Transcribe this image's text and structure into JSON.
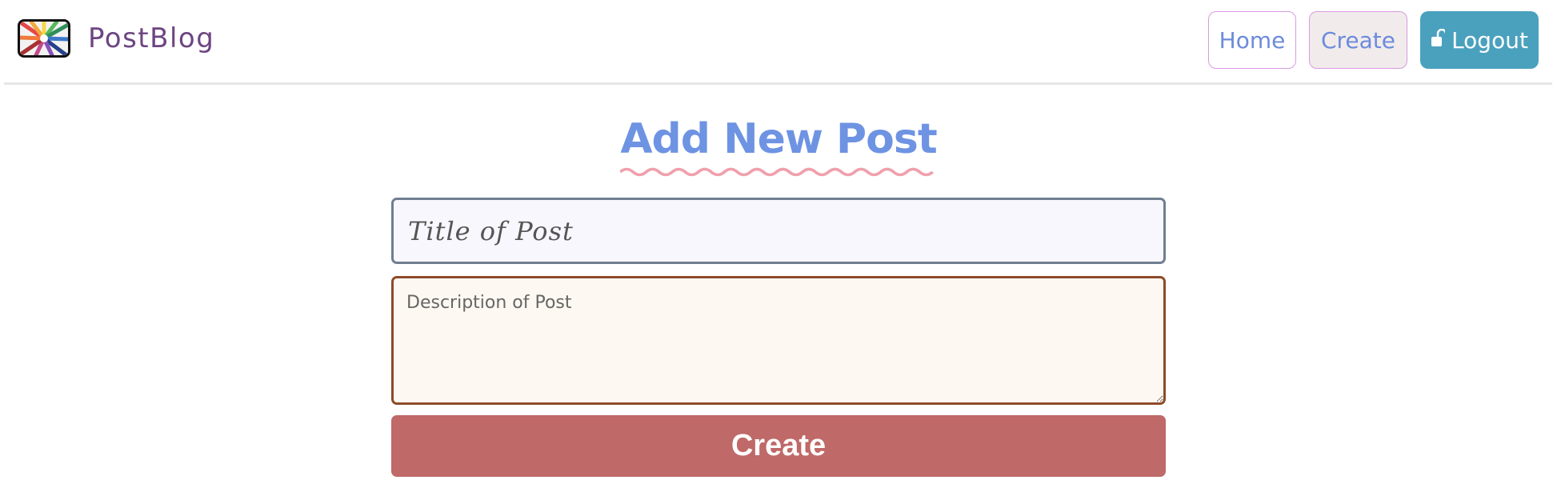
{
  "brand": {
    "name": "PostBlog",
    "logo_icon": "colored-pencils-logo"
  },
  "nav": {
    "home_label": "Home",
    "create_label": "Create",
    "logout_label": "Logout",
    "logout_icon": "unlock-icon"
  },
  "page": {
    "heading": "Add New Post"
  },
  "form": {
    "title_placeholder": "Title of Post",
    "title_value": "",
    "description_placeholder": "Description of Post",
    "description_value": "",
    "submit_label": "Create"
  },
  "colors": {
    "brand_text": "#6d4582",
    "nav_link_text": "#6c8bdc",
    "logout_bg": "#4aa1be",
    "heading": "#6e93e3",
    "heading_underline": "#f0a0ad",
    "title_border": "#707e90",
    "description_border": "#8f4a2a",
    "submit_bg": "#bf6968"
  }
}
